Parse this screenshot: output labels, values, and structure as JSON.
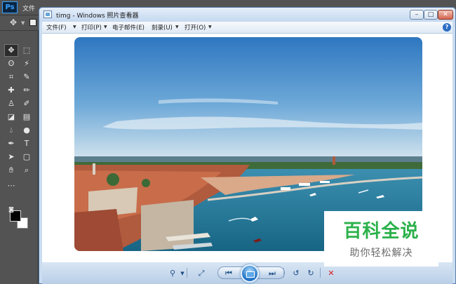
{
  "photoshop": {
    "logo": "Ps",
    "menu_first": "文件",
    "tools": [
      "move-icon",
      "marquee-icon",
      "lasso-icon",
      "magic-wand-icon",
      "crop-icon",
      "eyedropper-icon",
      "healing-icon",
      "brush-icon",
      "stamp-icon",
      "history-brush-icon",
      "eraser-icon",
      "gradient-icon",
      "blur-icon",
      "dodge-icon",
      "pen-icon",
      "type-icon",
      "path-select-icon",
      "shape-icon",
      "hand-icon",
      "zoom-icon",
      "more-icon"
    ]
  },
  "viewer": {
    "title": "timg - Windows 照片查看器",
    "menu": [
      {
        "label": "文件(F)",
        "has_arrow": true
      },
      {
        "label": "打印(P)",
        "has_arrow": true
      },
      {
        "label": "电子邮件(E)",
        "has_arrow": false
      },
      {
        "label": "刻录(U)",
        "has_arrow": true
      },
      {
        "label": "打开(O)",
        "has_arrow": true
      }
    ],
    "help": "?",
    "window_buttons": {
      "minimize": "–",
      "maximize": "□",
      "close": "✕"
    },
    "controls": {
      "zoom": "🔍︎",
      "fit": "⤢",
      "prev": "⏮",
      "next": "⏭",
      "rotate_ccw": "↺",
      "rotate_cw": "↻",
      "delete": "✕"
    }
  },
  "watermark": {
    "title": "百科全说",
    "subtitle": "助你轻松解决"
  },
  "colors": {
    "sky_top": "#2f79c2",
    "sky_bottom": "#cfe2ee",
    "water": "#1f6f93",
    "roofs": "#b95a3c",
    "watermark_green": "#2bb14a"
  }
}
